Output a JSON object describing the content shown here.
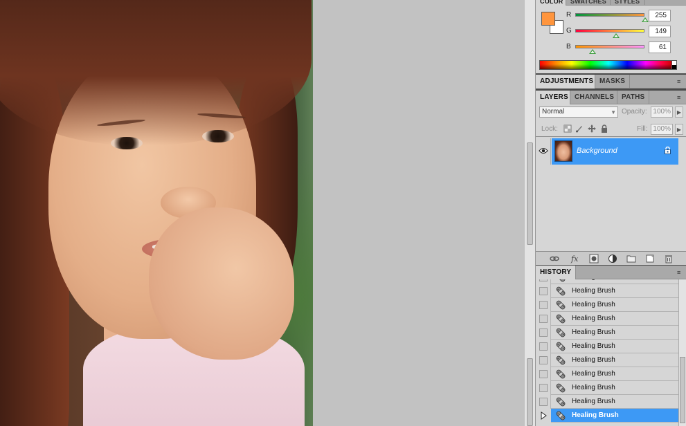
{
  "color_panel": {
    "tabs": [
      "COLOR",
      "SWATCHES",
      "STYLES"
    ],
    "foreground": "#ff953d",
    "background": "#ffffff",
    "channels": [
      {
        "label": "R",
        "value": "255",
        "level": 1.0
      },
      {
        "label": "G",
        "value": "149",
        "level": 0.584
      },
      {
        "label": "B",
        "value": "61",
        "level": 0.239
      }
    ]
  },
  "adjustments_panel": {
    "tabs": [
      "ADJUSTMENTS",
      "MASKS"
    ]
  },
  "layers_panel": {
    "tabs": [
      "LAYERS",
      "CHANNELS",
      "PATHS"
    ],
    "blend_mode": "Normal",
    "opacity_label": "Opacity:",
    "opacity_value": "100%",
    "lock_label": "Lock:",
    "fill_label": "Fill:",
    "fill_value": "100%",
    "layers": [
      {
        "name": "Background",
        "visible": true,
        "locked": true,
        "selected": true
      }
    ]
  },
  "history_panel": {
    "tabs": [
      "HISTORY"
    ],
    "items": [
      {
        "label": "Healing Brush",
        "active": false
      },
      {
        "label": "Healing Brush",
        "active": false
      },
      {
        "label": "Healing Brush",
        "active": false
      },
      {
        "label": "Healing Brush",
        "active": false
      },
      {
        "label": "Healing Brush",
        "active": false
      },
      {
        "label": "Healing Brush",
        "active": false
      },
      {
        "label": "Healing Brush",
        "active": false
      },
      {
        "label": "Healing Brush",
        "active": false
      },
      {
        "label": "Healing Brush",
        "active": false
      },
      {
        "label": "Healing Brush",
        "active": false
      },
      {
        "label": "Healing Brush",
        "active": true
      }
    ]
  },
  "colors": {
    "selection": "#3d99f5",
    "panel_bg": "#d6d6d6",
    "tab_bar": "#a9a9a9",
    "canvas_bg": "#c2c2c2"
  }
}
